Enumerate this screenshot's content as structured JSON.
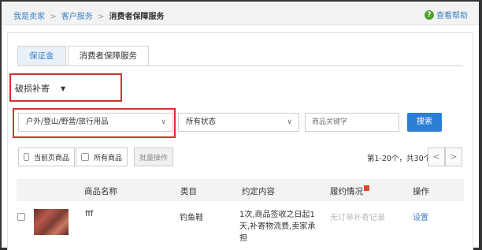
{
  "breadcrumb": {
    "items": [
      "我是卖家",
      "客户服务"
    ],
    "separator": ">",
    "current": "消费者保障服务"
  },
  "help": {
    "label": "查看帮助",
    "icon": "question-circle-icon"
  },
  "tabs": [
    {
      "label": "保证金",
      "active": false
    },
    {
      "label": "消费者保障服务",
      "active": true
    }
  ],
  "service_type": {
    "selected": "破损补寄",
    "icon": "caret-down-icon"
  },
  "filters": {
    "category": "户外/登山/野营/旅行用品",
    "status": "所有状态",
    "keyword_placeholder": "商品关键字",
    "search_label": "搜索"
  },
  "bulk": {
    "current_page_label": "当前页商品",
    "all_label": "所有商品",
    "batch_label": "批量操作"
  },
  "pager": {
    "text": "第1-20个，共30个",
    "prev": "<",
    "next": ">"
  },
  "table": {
    "headers": [
      "商品名称",
      "类目",
      "约定内容",
      "履约情况",
      "操作"
    ],
    "rows": [
      {
        "name": "fff",
        "category": "钓鱼鞋",
        "content": "1次,商品签收之日起1天,补寄物流费,卖家承担",
        "fulfillment": "无订单补寄记录",
        "action": "设置"
      }
    ]
  },
  "colors": {
    "link": "#3a7fc1",
    "primary_button": "#2a7fd4",
    "highlight": "#d32f2f",
    "help_icon": "#4ca42e"
  }
}
